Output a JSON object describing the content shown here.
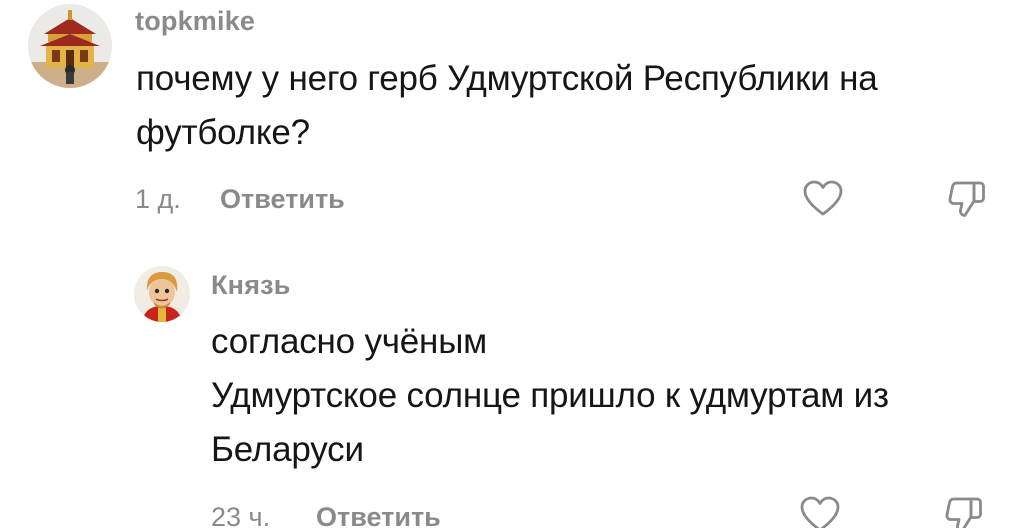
{
  "comments": [
    {
      "username": "topkmike",
      "lines": [
        "почему у него герб Удмуртской Республики на",
        "футболке?"
      ],
      "time": "1 д.",
      "reply_label": "Ответить",
      "avatar_icon": "temple-avatar"
    },
    {
      "username": "Князь",
      "lines": [
        "согласно учёным",
        "Удмуртское солнце пришло к удмуртам из",
        "Беларуси"
      ],
      "time": "23 ч.",
      "reply_label": "Ответить",
      "avatar_icon": "cartoon-prince-avatar"
    }
  ],
  "icons": {
    "like": "heart-icon",
    "dislike": "thumbs-down-icon"
  },
  "colors": {
    "text": "#161616",
    "secondary": "#8a8a8a",
    "background": "#ffffff"
  }
}
